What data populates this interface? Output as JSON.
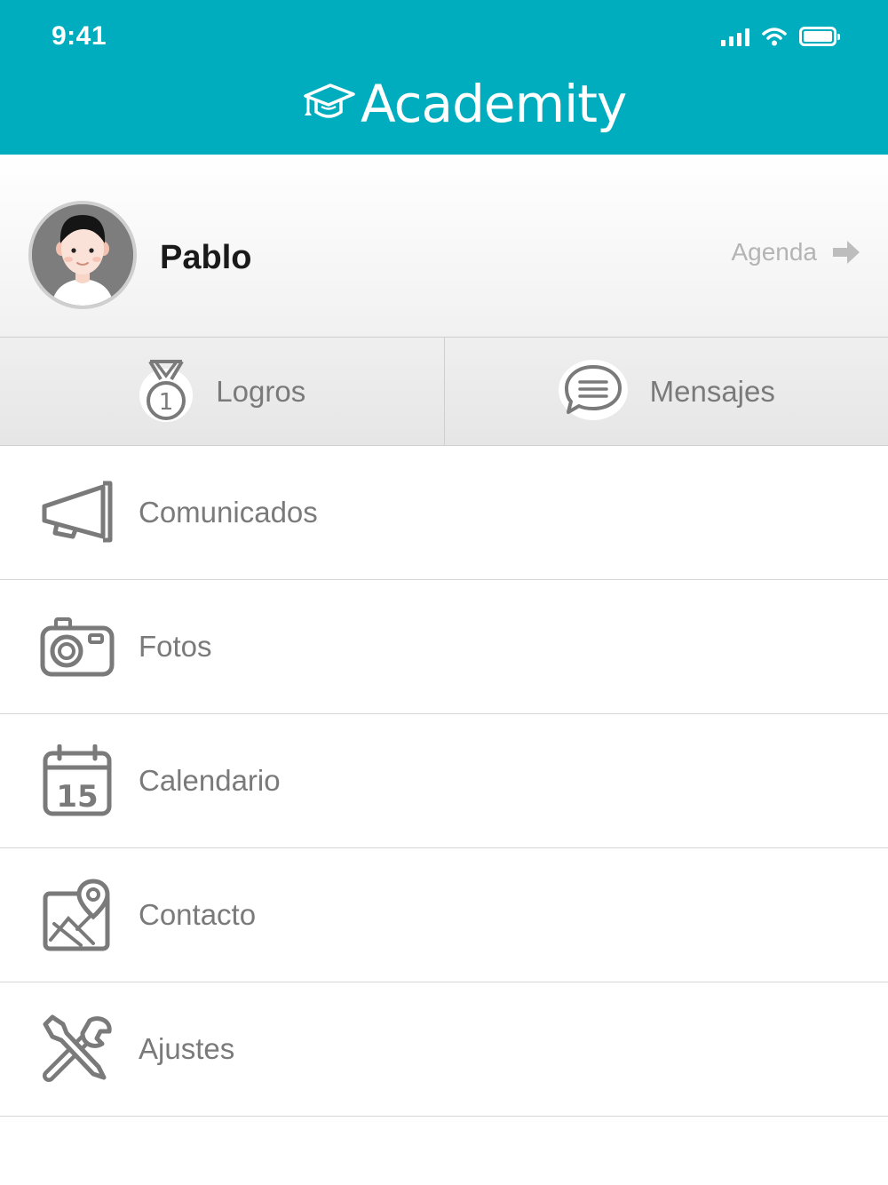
{
  "status_bar": {
    "time": "9:41"
  },
  "header": {
    "app_name": "Academity",
    "background_color": "#00adbf"
  },
  "profile": {
    "name": "Pablo",
    "agenda_label": "Agenda"
  },
  "tabs": [
    {
      "label": "Logros",
      "icon": "medal-icon"
    },
    {
      "label": "Mensajes",
      "icon": "chat-bubble-icon"
    }
  ],
  "menu": [
    {
      "label": "Comunicados",
      "icon": "megaphone-icon"
    },
    {
      "label": "Fotos",
      "icon": "camera-icon"
    },
    {
      "label": "Calendario",
      "icon": "calendar-icon",
      "icon_text": "15"
    },
    {
      "label": "Contacto",
      "icon": "map-pin-icon"
    },
    {
      "label": "Ajustes",
      "icon": "tools-icon"
    }
  ],
  "colors": {
    "accent": "#00adbf",
    "icon_gray": "#7a7a7a",
    "muted": "#b4b4b4"
  }
}
